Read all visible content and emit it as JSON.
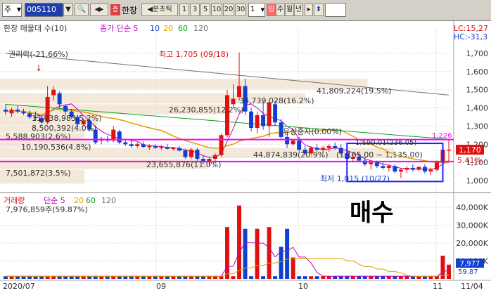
{
  "toolbar": {
    "market": "주",
    "code": "005110",
    "name": "한창",
    "minute_label": "분초틱",
    "periods": [
      "1",
      "3",
      "5",
      "10",
      "20",
      "30"
    ],
    "period_value": "1",
    "day_btn": "일",
    "week_btn": "주",
    "month_btn": "월",
    "year_btn": "년",
    "icon_names": [
      "dropdown-icon",
      "search-icon",
      "speaker-icon",
      "stock-icon",
      "arrow-left-icon",
      "arrow-right-icon",
      "updown-icon"
    ]
  },
  "price_panel": {
    "legend_name": "한창 매물대 수(10)",
    "legend_ma": "종가 단순 5",
    "ma_periods": [
      "10",
      "20",
      "60",
      "120"
    ],
    "lc_label": "LC:15,27",
    "hc_label": "HC:-31,3",
    "y_ticks": [
      "1,700",
      "1,600",
      "1,500",
      "1,400",
      "1,300",
      "1,200",
      "1,100",
      "1,000"
    ],
    "current_price": "1,170",
    "current_pct": "5.41%",
    "hline_value": "1,226",
    "annotations": {
      "rights": "권리락(-21,66%)",
      "high": "최고 1,705 (09/18)",
      "low": "최저 1,015 (10/27)",
      "capital": "유상증자(0.00%)",
      "range": "(1,165.00 ~ 1,135.00)",
      "small": "1,190.01(236.05)"
    },
    "volume_profile": [
      "41,809,224(19.5%)",
      "34,739,028(16.2%)",
      "26,230,855(12.2%)",
      "11,038,983(5.2%)",
      "8,500,392(4.0%)",
      "5,588,903(2.6%)",
      "10,190,536(4.8%)",
      "44,874,839(20.9%)",
      "23,655,876(11.0%)",
      "7,501,872(3.5%)"
    ]
  },
  "volume_panel": {
    "legend_name": "거래량",
    "legend_ma": "단순 5",
    "ma_periods": [
      "20",
      "60",
      "120"
    ],
    "current_volume": "7,976,859주(59.87%)",
    "y_ticks": [
      "40,000K",
      "30,000K",
      "20,000K",
      "10,000K"
    ],
    "tag_value": "7,977",
    "tag_pct": "59.87"
  },
  "x_labels": [
    "2020/07",
    "09",
    "10",
    "11",
    "11/04"
  ],
  "overlay_text": "매수",
  "colors": {
    "up": "#e01010",
    "down": "#1040d0",
    "ma5": "#c000c0",
    "ma20": "#e0a000",
    "ma60": "#10a020",
    "ma120": "#707070",
    "hline": "#ff00ff",
    "profile": "#f3e6d6",
    "box": "#2020ff"
  },
  "chart_data": {
    "type": "candlestick",
    "x": [
      "2020-07",
      "2020-09",
      "2020-10",
      "2020-11",
      "2020-11-04"
    ],
    "high": 1705,
    "high_date": "09/18",
    "low": 1015,
    "low_date": "10/27",
    "last_close": 1170,
    "last_change_pct": 5.41,
    "reference_line": 1226,
    "y_range": [
      950,
      1800
    ],
    "volume_range": [
      0,
      42000000
    ],
    "last_volume": 7976859
  }
}
